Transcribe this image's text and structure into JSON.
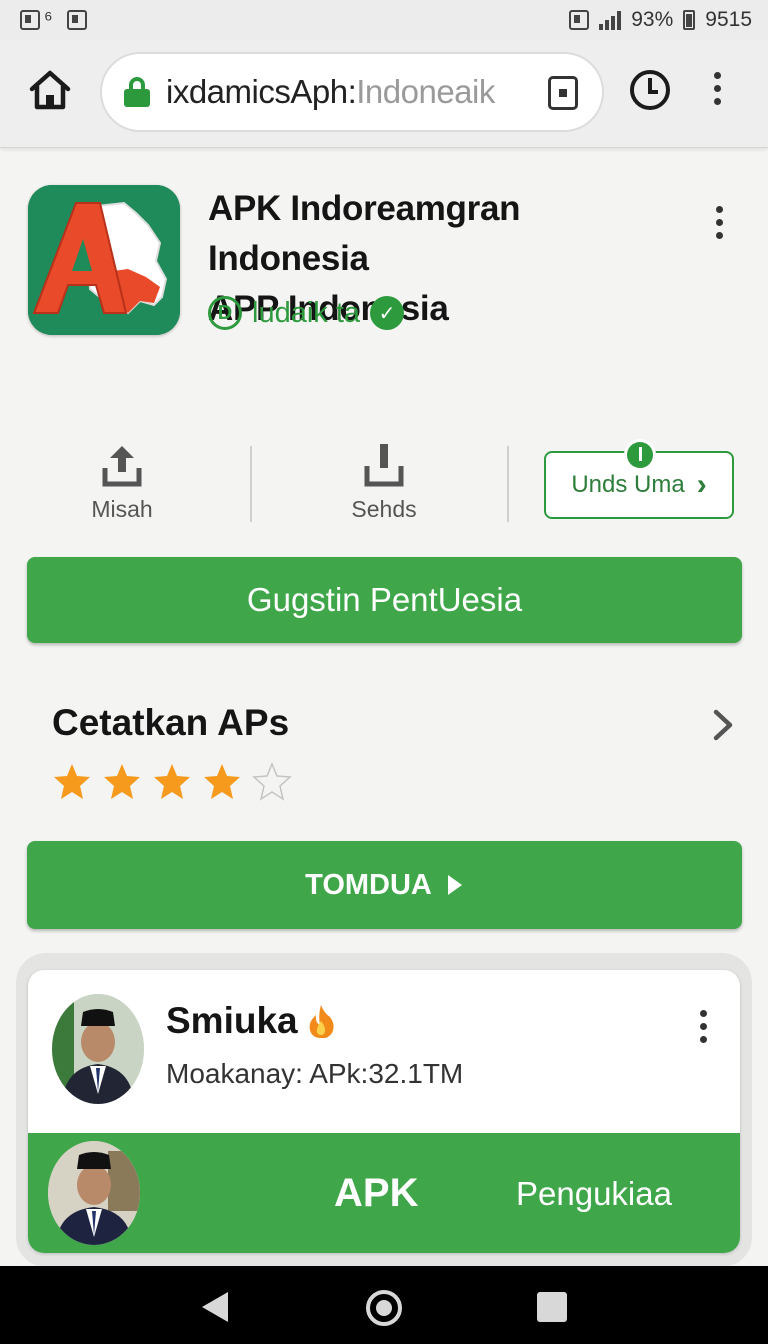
{
  "status_bar": {
    "left_icons_text": "⁶",
    "battery": "93%",
    "time": "9515"
  },
  "browser": {
    "url_main": "ixdamicsAph:",
    "url_dim": "Indoneaik"
  },
  "app": {
    "title_line1": "APK Indoreamgran Indonesia",
    "title_line2": "APP Indonesia",
    "developer": "ludaik ta",
    "dev_badge": "D",
    "verified_symbol": "✓",
    "icon_colors": {
      "bg": "#1f8a5a",
      "letter": "#e84a2a",
      "map": "#ffffff"
    }
  },
  "actions": [
    {
      "label": "Misah",
      "icon": "share-icon"
    },
    {
      "label": "Sehds",
      "icon": "download-icon"
    }
  ],
  "outline_button": {
    "label": "Unds Uma",
    "arrow": "›"
  },
  "primary_button": {
    "label": "Gugstin PentUesia"
  },
  "rating_section": {
    "title": "Cetatkan APs",
    "rating": 4,
    "max": 5
  },
  "secondary_button": {
    "label": "TOMDUA"
  },
  "list_card": {
    "name": "Smiuka",
    "subtitle": "Moakanay: APk:32.1TM",
    "band_title": "APK",
    "band_label": "Pengukiaa"
  },
  "colors": {
    "accent_green": "#3fa64a",
    "star": "#f59a1c"
  }
}
